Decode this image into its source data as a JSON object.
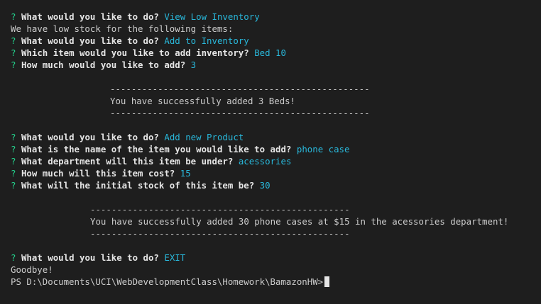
{
  "colors": {
    "background": "#1e1e1e",
    "prompt_mark": "#23d18b",
    "answer": "#29b8db",
    "text": "#cccccc"
  },
  "mark": "?",
  "block1": {
    "q1": "What would you like to do?",
    "a1": "View Low Inventory",
    "info": "We have low stock for the following items:",
    "q2": "What would you like to do?",
    "a2": "Add to Inventory",
    "q3": "Which item would you like to add inventory?",
    "a3": "Bed 10",
    "q4": "How much would you like to add?",
    "a4": "3"
  },
  "msg1": {
    "divider": "-------------------------------------------------",
    "text": "You have successfully added 3 Beds!"
  },
  "block2": {
    "q1": "What would you like to do?",
    "a1": "Add new Product",
    "q2": "What is the name of the item you would like to add?",
    "a2": "phone case",
    "q3": "What department will this item be under?",
    "a3": "acessories",
    "q4": "How much will this item cost?",
    "a4": "15",
    "q5": "What will the initial stock of this item be?",
    "a5": "30"
  },
  "msg2": {
    "divider": "-------------------------------------------------",
    "text": "You have successfully added 30 phone cases at $15 in the acessories department!"
  },
  "block3": {
    "q1": "What would you like to do?",
    "a1": "EXIT",
    "bye": "Goodbye!",
    "prompt": "PS D:\\Documents\\UCI\\WebDevelopmentClass\\Homework\\BamazonHW>"
  }
}
